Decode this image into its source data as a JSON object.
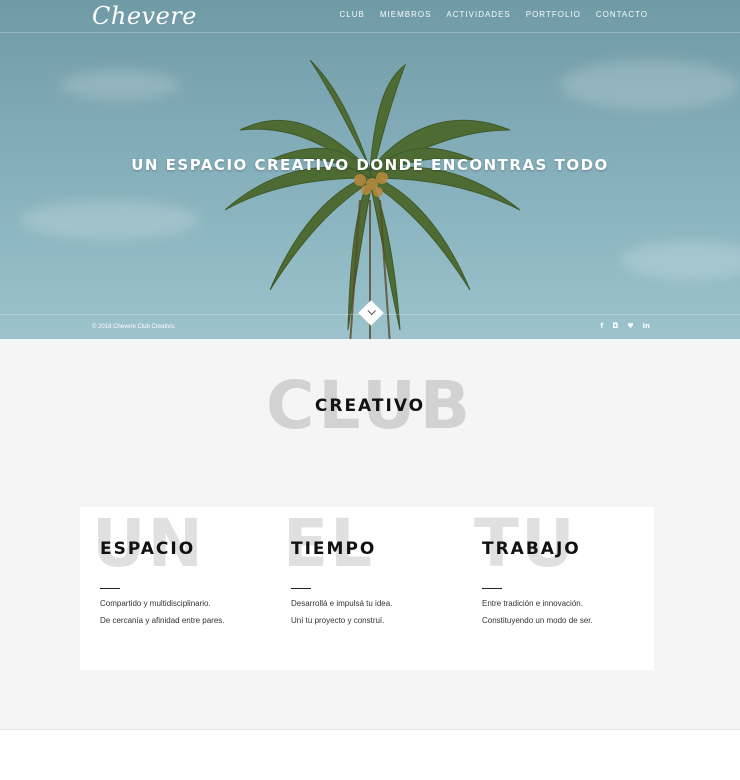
{
  "header": {
    "logo": "Chevere",
    "nav": [
      "CLUB",
      "MIEMBROS",
      "ACTIVIDADES",
      "PORTFOLIO",
      "CONTACTO"
    ]
  },
  "hero": {
    "title": "UN ESPACIO CREATIVO DONDE ENCONTRAS TODO",
    "scroll_icon": "chevron-down-icon",
    "copyright": "© 2018 Chevere Club Creativo.",
    "social": [
      {
        "icon": "facebook-icon",
        "glyph": "f"
      },
      {
        "icon": "instagram-icon",
        "glyph": "◘"
      },
      {
        "icon": "twitter-icon",
        "glyph": "♥"
      },
      {
        "icon": "linkedin-icon",
        "glyph": "in"
      }
    ]
  },
  "club": {
    "background_word": "CLUB",
    "heading": "CREATIVO"
  },
  "cards": [
    {
      "bg_word": "UN",
      "title": "ESPACIO",
      "line1": "Compartido y multidisciplinario.",
      "line2": "De cercanía y afinidad entre pares."
    },
    {
      "bg_word": "EL",
      "title": "TIEMPO",
      "line1": "Desarrollá e impulsá tu idea.",
      "line2": "Uní tu proyecto y construí."
    },
    {
      "bg_word": "TU",
      "title": "TRABAJO",
      "line1": "Entre tradición e innovación.",
      "line2": "Constituyendo un modo de ser."
    }
  ]
}
